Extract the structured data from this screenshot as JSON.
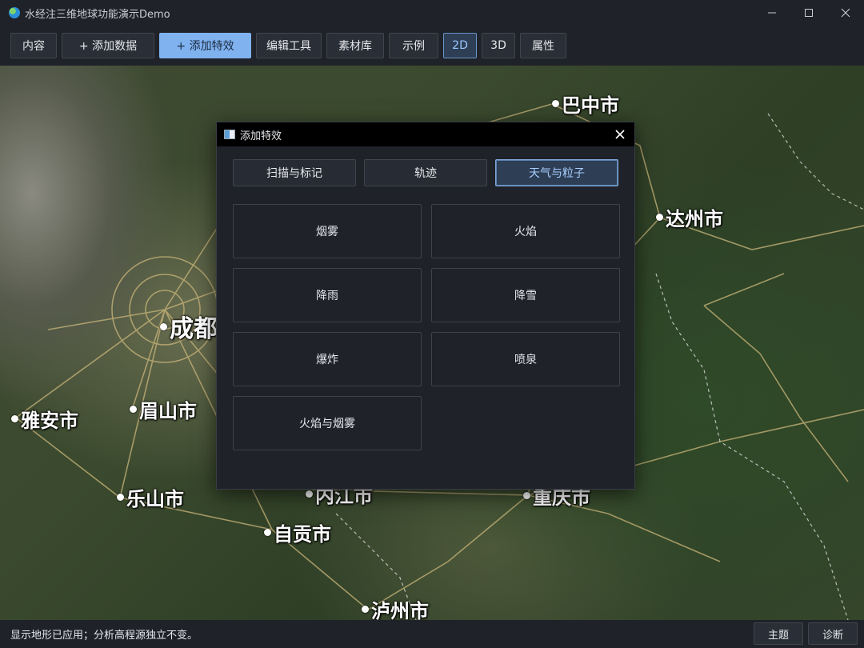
{
  "window": {
    "title": "水经注三维地球功能演示Demo",
    "app_icon": "globe-icon",
    "controls": [
      "minimize-icon",
      "maximize-icon",
      "close-icon"
    ]
  },
  "toolbar": {
    "items": [
      {
        "label": "内容"
      },
      {
        "label": "+ 添加数据"
      },
      {
        "label": "+ 添加特效",
        "state": "highlighted"
      },
      {
        "label": "编辑工具"
      },
      {
        "label": "素材库"
      },
      {
        "label": "示例"
      },
      {
        "label": "2D",
        "state": "selected"
      },
      {
        "label": "3D"
      },
      {
        "label": "属性"
      }
    ]
  },
  "map": {
    "cities": [
      {
        "label": "巴中市"
      },
      {
        "label": "达州市"
      },
      {
        "label": "成都"
      },
      {
        "label": "雅安市"
      },
      {
        "label": "眉山市"
      },
      {
        "label": "乐山市"
      },
      {
        "label": "内江市"
      },
      {
        "label": "重庆市"
      },
      {
        "label": "自贡市"
      },
      {
        "label": "泸州市"
      }
    ]
  },
  "dialog": {
    "title": "添加特效",
    "icon": "window-icon",
    "tabs": [
      {
        "label": "扫描与标记"
      },
      {
        "label": "轨迹"
      },
      {
        "label": "天气与粒子",
        "active": true
      }
    ],
    "effects": [
      {
        "label": "烟雾"
      },
      {
        "label": "火焰"
      },
      {
        "label": "降雨"
      },
      {
        "label": "降雪"
      },
      {
        "label": "爆炸"
      },
      {
        "label": "喷泉"
      },
      {
        "label": "火焰与烟雾"
      }
    ]
  },
  "statusbar": {
    "message": "显示地形已应用；分析高程源独立不变。",
    "buttons": [
      {
        "label": "主题"
      },
      {
        "label": "诊断"
      }
    ]
  },
  "colors": {
    "background": "#1f2228",
    "accent": "#7fb2ef",
    "selected_border": "#7fa7d6",
    "dialog_header": "#000000"
  }
}
